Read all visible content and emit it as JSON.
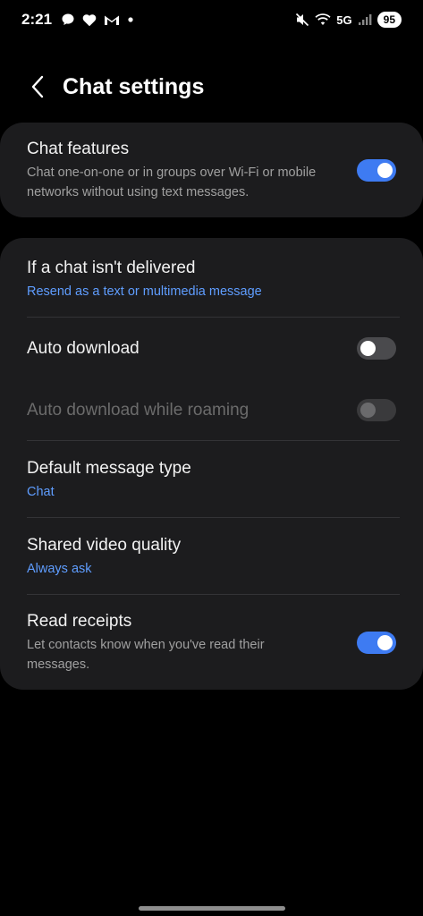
{
  "status_bar": {
    "time": "2:21",
    "network": "5G",
    "battery": "95",
    "left_icons": [
      "chat-bubble-icon",
      "heart-icon",
      "gmail-icon",
      "dot-icon"
    ],
    "right_icons": [
      "mute-icon",
      "wifi-icon",
      "signal-icon"
    ]
  },
  "header": {
    "title": "Chat settings"
  },
  "settings": {
    "chat_features": {
      "title": "Chat features",
      "subtitle": "Chat one-on-one or in groups over Wi-Fi or mobile networks without using text messages.",
      "enabled": true
    },
    "not_delivered": {
      "title": "If a chat isn't delivered",
      "value": "Resend as a text or multimedia message"
    },
    "auto_download": {
      "title": "Auto download",
      "enabled": false
    },
    "auto_download_roaming": {
      "title": "Auto download while roaming",
      "enabled": false,
      "disabled": true
    },
    "default_message_type": {
      "title": "Default message type",
      "value": "Chat"
    },
    "shared_video_quality": {
      "title": "Shared video quality",
      "value": "Always ask"
    },
    "read_receipts": {
      "title": "Read receipts",
      "subtitle": "Let contacts know when you've read their messages.",
      "enabled": true
    }
  },
  "colors": {
    "accent": "#3e7bf2",
    "link": "#5f9dff",
    "card": "#1c1c1e",
    "background": "#000000"
  }
}
